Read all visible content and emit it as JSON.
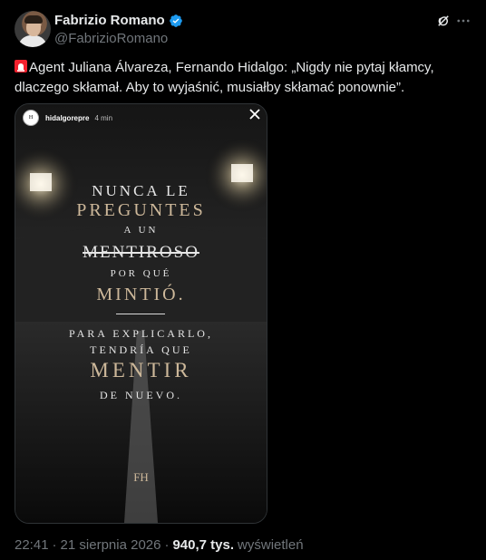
{
  "author": {
    "display_name": "Fabrizio Romano",
    "handle": "@FabrizioRomano",
    "verified": true
  },
  "icons": {
    "verified": "verified-badge-icon",
    "grok": "grok-icon",
    "more": "more-icon",
    "siren": "siren-icon",
    "close": "close-icon"
  },
  "tweet": {
    "text": "Agent Juliana Álvareza, Fernando Hidalgo: „Nigdy nie pytaj kłamcy, dlaczego skłamał. Aby to wyjaśnić, musiałby skłamać ponownie”."
  },
  "media": {
    "story_user": "hidalgorepre",
    "story_time": "4 min",
    "avatar_text": "H",
    "quote_lines": [
      "NUNCA LE",
      "PREGUNTES",
      "A UN",
      "MENTIROSO",
      "POR QUÉ",
      "MINTIÓ.",
      "PARA EXPLICARLO,",
      "TENDRÍA QUE",
      "MENTIR",
      "DE NUEVO."
    ],
    "monogram": "FH"
  },
  "footer": {
    "time": "22:41",
    "date": "21 sierpnia 2026",
    "views_count": "940,7 tys.",
    "views_label": "wyświetleń",
    "separator": "·"
  },
  "colors": {
    "background": "#000000",
    "text": "#e7e9ea",
    "muted": "#71767b",
    "verified": "#1d9bf0",
    "gold": "#cdb89a"
  }
}
